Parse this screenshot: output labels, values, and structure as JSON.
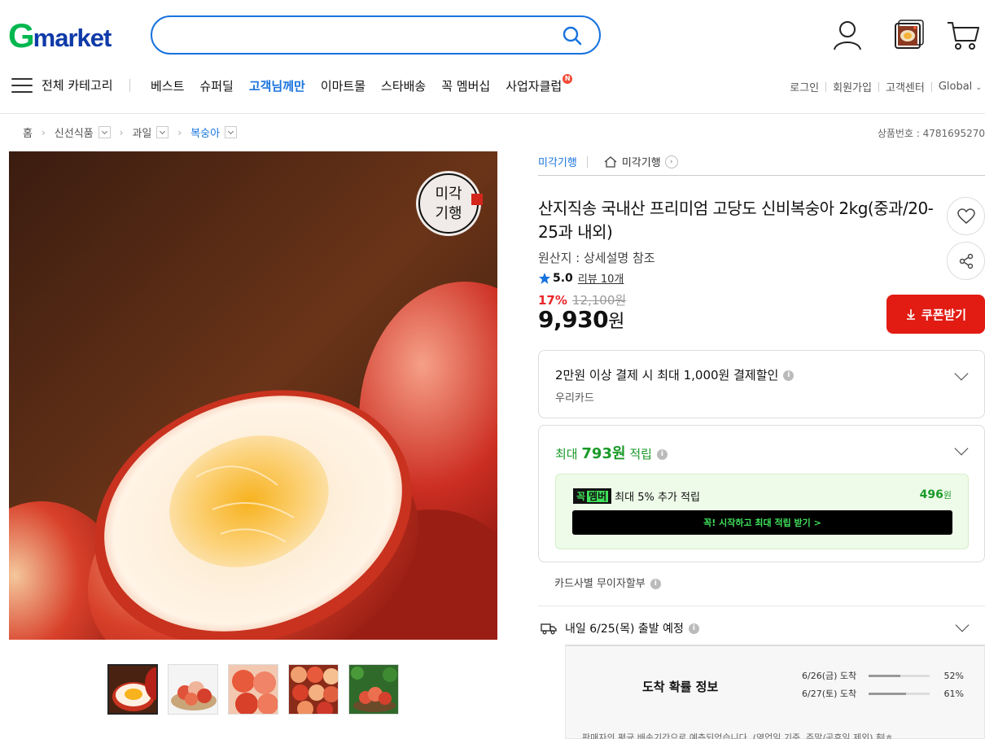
{
  "header": {
    "logo_g": "G",
    "logo_rest": "market",
    "search_placeholder": ""
  },
  "nav": {
    "all_categories": "전체 카테고리",
    "items": [
      "베스트",
      "슈퍼딜",
      "고객님께만",
      "이마트몰",
      "스타배송",
      "꼭 멤버십",
      "사업자클럽"
    ],
    "new_badge": "N",
    "util": [
      "로그인",
      "회원가입",
      "고객센터",
      "Global"
    ]
  },
  "breadcrumb": {
    "items": [
      "홈",
      "신선식품",
      "과일",
      "복숭아"
    ],
    "product_no": "상품번호 : 4781695270"
  },
  "seller": {
    "name": "미각기행",
    "store": "미각기행"
  },
  "product": {
    "brand_mark": "미각기행",
    "title": "산지직송 국내산 프리미엄 고당도 신비복숭아 2kg(중과/20-25과 내외)",
    "origin": "원산지 : 상세설명 참조",
    "rating": "5.0",
    "reviews": "리뷰 10개",
    "discount": "17%",
    "original_price": "12,100원",
    "price": "9,930",
    "price_unit": "원",
    "coupon": "쿠폰받기"
  },
  "payment": {
    "title": "2만원 이상 결제 시 최대 1,000원 결제할인",
    "card": "우리카드"
  },
  "points": {
    "prefix": "최대",
    "amount": "793원",
    "suffix": "적립",
    "member_logo": "꼭",
    "member_logo2": "멤버",
    "member_text": "최대 5% 추가 적립",
    "member_amount": "496",
    "member_unit": "원",
    "member_cta": "꼭! 시작하고 최대 적립 받기 >"
  },
  "installment": "카드사별 무이자할부",
  "shipping": {
    "departure": "내일 6/25(목) 출발 예정",
    "arrival_title": "도착 확률 정보",
    "arrivals": [
      {
        "label": "6/26(금) 도착",
        "pct": "52%",
        "value": 0.52
      },
      {
        "label": "6/27(토) 도착",
        "pct": "61%",
        "value": 0.61
      }
    ],
    "note": "판매자의 평균 배송기간으로 예측되었습니다. (영업일 기준, 주말/공휴일 제외) 刻ㅎ"
  },
  "colors": {
    "brand_green": "#00b74f",
    "brand_blue": "#1873de",
    "sale_red": "#e21b13",
    "point_green": "#1a9a28"
  }
}
